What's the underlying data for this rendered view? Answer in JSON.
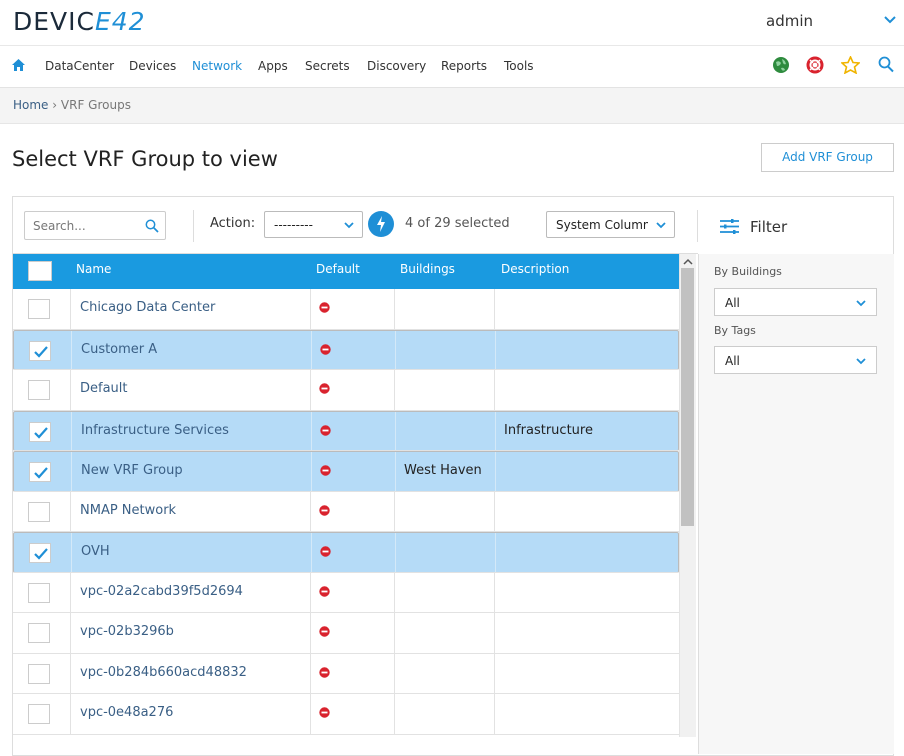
{
  "header": {
    "logo_left": "DEVIC",
    "logo_mid": "E",
    "logo_right": "42",
    "user": "admin"
  },
  "nav": {
    "items": [
      "DataCenter",
      "Devices",
      "Network",
      "Apps",
      "Secrets",
      "Discovery",
      "Reports",
      "Tools"
    ],
    "active": "Network",
    "icons": [
      "home-icon",
      "globe-icon",
      "lifebuoy-icon",
      "star-icon",
      "search-icon"
    ]
  },
  "breadcrumb": {
    "home": "Home",
    "sep": "›",
    "current": "VRF Groups"
  },
  "page": {
    "title": "Select VRF Group to view",
    "add_button": "Add VRF Group"
  },
  "toolbar": {
    "search_placeholder": "Search...",
    "action_label": "Action:",
    "action_value": "---------",
    "selected_text": "4 of 29 selected",
    "system_columns": "System Columns",
    "filter_label": "Filter"
  },
  "table": {
    "columns": [
      "Name",
      "Default",
      "Buildings",
      "Description"
    ],
    "rows": [
      {
        "name": "Chicago Data Center",
        "default": "no",
        "buildings": "",
        "description": "",
        "selected": false
      },
      {
        "name": "Customer A",
        "default": "no",
        "buildings": "",
        "description": "",
        "selected": true
      },
      {
        "name": "Default",
        "default": "no",
        "buildings": "",
        "description": "",
        "selected": false
      },
      {
        "name": "Infrastructure Services",
        "default": "no",
        "buildings": "",
        "description": "Infrastructure",
        "selected": true
      },
      {
        "name": "New VRF Group",
        "default": "no",
        "buildings": "West Haven",
        "description": "",
        "selected": true
      },
      {
        "name": "NMAP Network",
        "default": "no",
        "buildings": "",
        "description": "",
        "selected": false
      },
      {
        "name": "OVH",
        "default": "no",
        "buildings": "",
        "description": "",
        "selected": true
      },
      {
        "name": "vpc-02a2cabd39f5d2694",
        "default": "no",
        "buildings": "",
        "description": "",
        "selected": false
      },
      {
        "name": "vpc-02b3296b",
        "default": "no",
        "buildings": "",
        "description": "",
        "selected": false
      },
      {
        "name": "vpc-0b284b660acd48832",
        "default": "no",
        "buildings": "",
        "description": "",
        "selected": false
      },
      {
        "name": "vpc-0e48a276",
        "default": "no",
        "buildings": "",
        "description": "",
        "selected": false
      }
    ]
  },
  "sidebar": {
    "by_buildings_label": "By Buildings",
    "by_buildings_value": "All",
    "by_tags_label": "By Tags",
    "by_tags_value": "All"
  },
  "colors": {
    "accent": "#1a9ae0",
    "selected_row": "#b5dbf7",
    "link": "#3a5f85",
    "no_icon": "#d9232e"
  }
}
